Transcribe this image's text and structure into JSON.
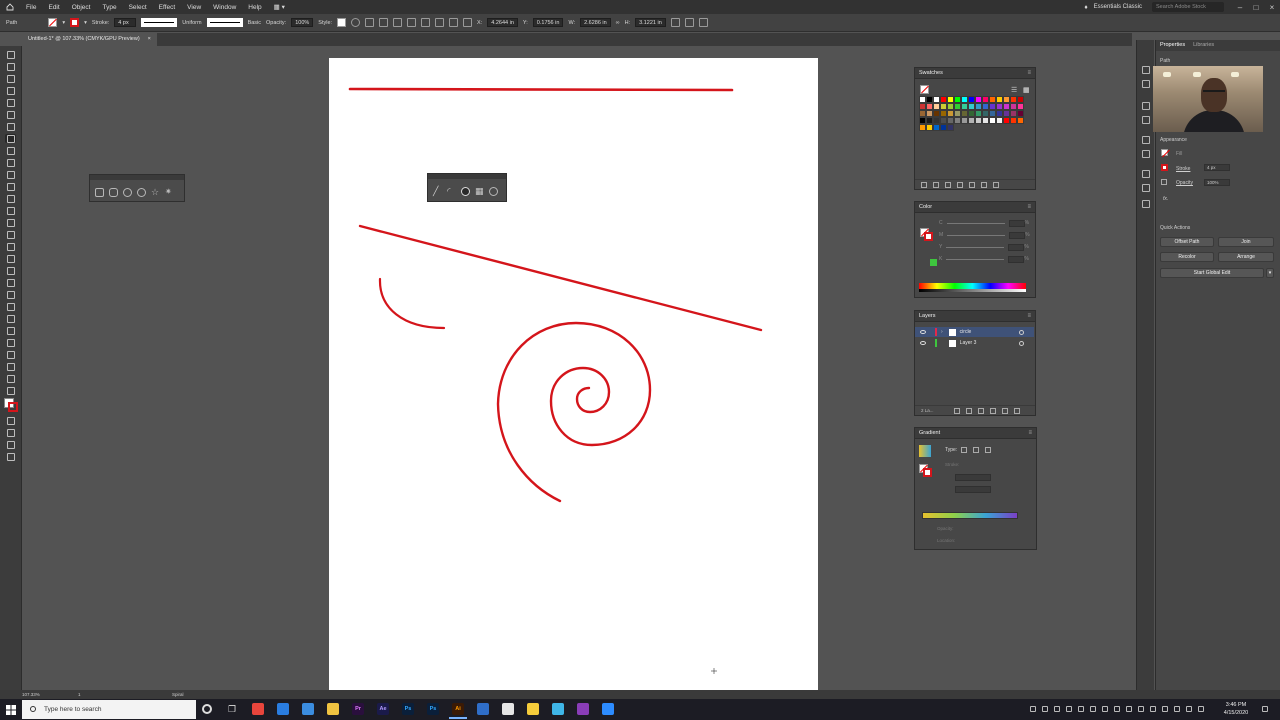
{
  "menubar": {
    "items": [
      "File",
      "Edit",
      "Object",
      "Type",
      "Select",
      "Effect",
      "View",
      "Window",
      "Help"
    ],
    "workspace": "Essentials Classic",
    "stock_search_placeholder": "Search Adobe Stock"
  },
  "controlbar": {
    "selection_type": "Path",
    "stroke_label": "Stroke:",
    "stroke_weight": "4 px",
    "variable_width": "Uniform",
    "brush": "Basic",
    "opacity_label": "Opacity:",
    "opacity_value": "100%",
    "style_label": "Style:",
    "x_value": "4.2644 in",
    "y_value": "0.1756 in",
    "w_value": "2.6286 in",
    "h_value": "3.1221 in"
  },
  "document": {
    "tab_title": "Untitled-1* @ 107.33% (CMYK/GPU Preview)"
  },
  "panels": {
    "swatches": {
      "title": "Swatches",
      "colors": [
        "#ffffff",
        "#000000",
        "#ffffff",
        "#ff0000",
        "#ffff00",
        "#00ff00",
        "#00ffff",
        "#0000ff",
        "#ff00ff",
        "#ff0066",
        "#ff6600",
        "#ffcc00",
        "#ff9933",
        "#ff3300",
        "#cc0000",
        "#cc3333",
        "#ff6666",
        "#ffcc99",
        "#cccc33",
        "#99cc33",
        "#33cc33",
        "#33cc99",
        "#33cccc",
        "#3399cc",
        "#3366cc",
        "#6633cc",
        "#9933cc",
        "#cc33cc",
        "#cc3399",
        "#ff3399",
        "#996633",
        "#cc9966",
        "#663300",
        "#996600",
        "#cc9933",
        "#999966",
        "#666633",
        "#336633",
        "#339966",
        "#336666",
        "#336699",
        "#333399",
        "#663399",
        "#993366",
        "#660033",
        "#000000",
        "#1a1a1a",
        "#333333",
        "#4d4d4d",
        "#666666",
        "#808080",
        "#999999",
        "#b3b3b3",
        "#cccccc",
        "#e6e6e6",
        "#ffffff",
        "#f2f2f2",
        "#ff0000",
        "#ff3300",
        "#ff6600",
        "#ff9900",
        "#ffcc00",
        "#0066cc",
        "#003399",
        "#333366"
      ]
    },
    "color": {
      "title": "Color",
      "channels": [
        "C",
        "M",
        "Y",
        "K"
      ]
    },
    "layers": {
      "title": "Layers",
      "rows": [
        {
          "name": "circle",
          "color": "#e4284b",
          "selected": true
        },
        {
          "name": "Layer 3",
          "color": "#3ec63e",
          "selected": false
        }
      ],
      "count": "2 La..."
    },
    "gradient": {
      "title": "Gradient",
      "type_label": "Type:",
      "stroke_label": "Stroke:",
      "opacity_label": "Opacity:",
      "location_label": "Location:"
    }
  },
  "properties": {
    "tab_properties": "Properties",
    "tab_libraries": "Libraries",
    "selection": "Path",
    "appearance_label": "Appearance",
    "fill_label": "Fill",
    "stroke_label": "Stroke",
    "stroke_weight": "4 px",
    "opacity_label": "Opacity",
    "opacity_value": "100%",
    "fx_label": "fx.",
    "quick_actions_label": "Quick Actions",
    "buttons": {
      "offset_path": "Offset Path",
      "join": "Join",
      "recolor": "Recolor",
      "arrange": "Arrange",
      "global_edit": "Start Global Edit"
    }
  },
  "statusbar": {
    "zoom": "107.33%",
    "artboard": "1",
    "tool": "Spiral"
  },
  "taskbar": {
    "search_placeholder": "Type here to search",
    "time": "3:46 PM",
    "date": "4/15/2020",
    "apps": [
      {
        "icon": "chrome-icon",
        "label": "",
        "color": "#e8453c"
      },
      {
        "icon": "edge-icon",
        "label": "",
        "color": "#2a7de1"
      },
      {
        "icon": "edge-legacy-icon",
        "label": "",
        "color": "#3b8de0"
      },
      {
        "icon": "file-explorer-icon",
        "label": "",
        "color": "#f0c341"
      },
      {
        "icon": "premiere-icon",
        "label": "Pr",
        "color": "#2a0f3d"
      },
      {
        "icon": "after-effects-icon",
        "label": "Ae",
        "color": "#1a1a4a"
      },
      {
        "icon": "photoshop-icon",
        "label": "Ps",
        "color": "#0a1f3a"
      },
      {
        "icon": "photoshop-2-icon",
        "label": "Ps",
        "color": "#0a1f3a"
      },
      {
        "icon": "illustrator-icon",
        "label": "Ai",
        "color": "#3a1a05"
      },
      {
        "icon": "outlook-icon",
        "label": "",
        "color": "#2f6ec9"
      },
      {
        "icon": "notepad-icon",
        "label": "",
        "color": "#e6e6e6"
      },
      {
        "icon": "stickies-icon",
        "label": "",
        "color": "#f5cc3b"
      },
      {
        "icon": "app-icon",
        "label": "",
        "color": "#3fb6e8"
      },
      {
        "icon": "onenote-icon",
        "label": "",
        "color": "#8a3db8"
      },
      {
        "icon": "zoom-icon",
        "label": "",
        "color": "#2d8cff"
      }
    ]
  },
  "colors": {
    "stroke_red": "#d4151b",
    "selection_blue": "#3f5278",
    "ui_dark": "#323232",
    "ui_mid": "#535353"
  }
}
